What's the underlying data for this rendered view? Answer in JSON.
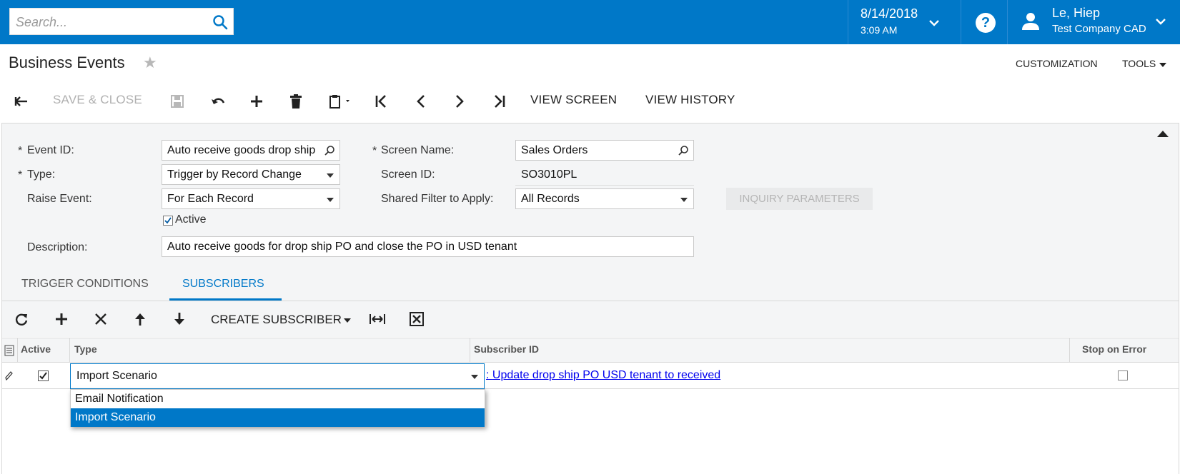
{
  "colors": {
    "brand": "#0078c8",
    "selection": "#0078c8",
    "link": "#0000ee"
  },
  "header": {
    "search_placeholder": "Search...",
    "date": "8/14/2018",
    "time": "3:09 AM",
    "help_label": "?",
    "user_name": "Le, Hiep",
    "user_company": "Test Company CAD"
  },
  "title_bar": {
    "title": "Business Events",
    "customization": "CUSTOMIZATION",
    "tools": "TOOLS"
  },
  "toolbar": {
    "save_close": "SAVE & CLOSE",
    "view_screen": "VIEW SCREEN",
    "view_history": "VIEW HISTORY"
  },
  "form": {
    "req_marker": "*",
    "event_id_label": "Event ID:",
    "event_id_value": "Auto receive goods drop ship",
    "type_label": "Type:",
    "type_value": "Trigger by Record Change",
    "raise_event_label": "Raise Event:",
    "raise_event_value": "For Each Record",
    "active_label": "Active",
    "active_checked": true,
    "description_label": "Description:",
    "description_value": "Auto receive goods for drop ship PO and close the PO in USD tenant",
    "screen_name_label": "Screen Name:",
    "screen_name_value": "Sales Orders",
    "screen_id_label": "Screen ID:",
    "screen_id_value": "SO3010PL",
    "shared_filter_label": "Shared Filter to Apply:",
    "shared_filter_value": "All Records",
    "inquiry_button": "INQUIRY PARAMETERS"
  },
  "tabs": [
    {
      "label": "TRIGGER CONDITIONS",
      "active": false
    },
    {
      "label": "SUBSCRIBERS",
      "active": true
    }
  ],
  "grid": {
    "create_subscriber": "CREATE SUBSCRIBER",
    "columns": [
      "Active",
      "Type",
      "Subscriber ID",
      "Stop on Error"
    ],
    "rows": [
      {
        "active": true,
        "type": "Import Scenario",
        "subscriber_id": "Update drop ship PO USD tenant to received",
        "stop_on_error": false
      }
    ],
    "type_options": [
      "Email Notification",
      "Import Scenario"
    ],
    "selected_option": "Import Scenario"
  }
}
